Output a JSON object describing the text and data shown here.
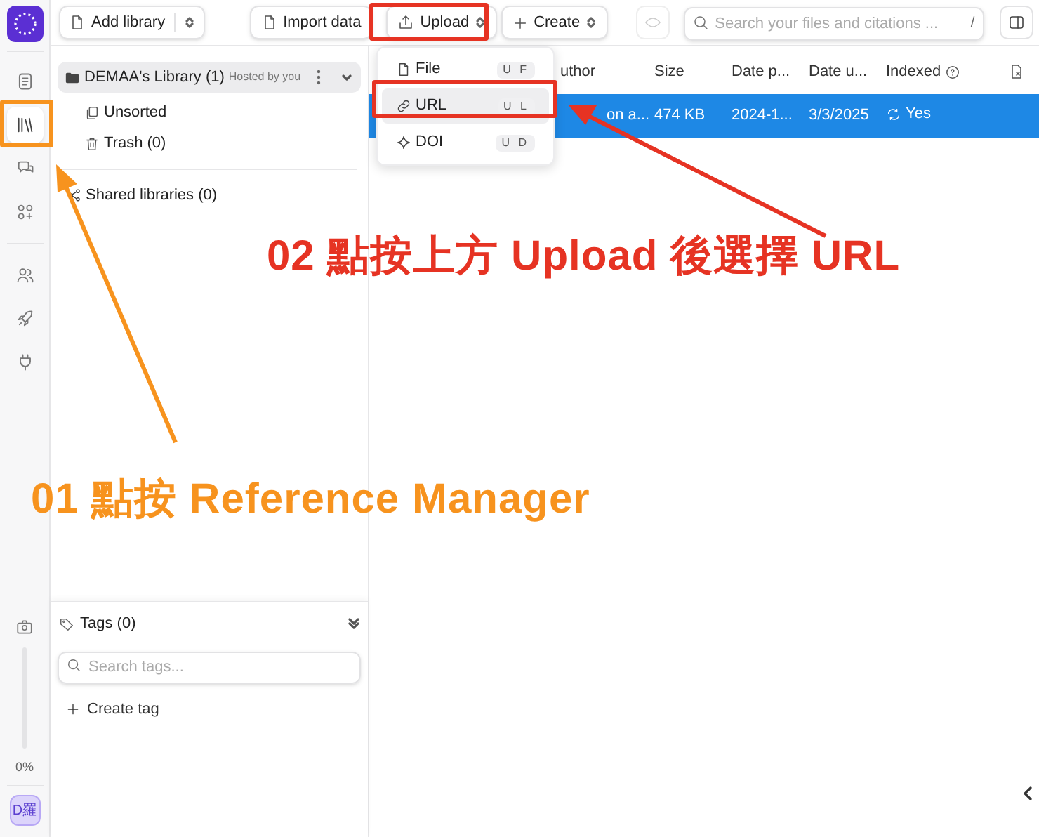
{
  "rail": {
    "items": [
      {
        "kind": "document",
        "selected": false
      },
      {
        "kind": "library",
        "selected": true
      },
      {
        "kind": "chat",
        "selected": false
      },
      {
        "kind": "apps",
        "selected": false
      },
      {
        "kind": "people",
        "selected": false
      },
      {
        "kind": "rocket",
        "selected": false
      },
      {
        "kind": "plug",
        "selected": false
      }
    ],
    "usage": {
      "level": 0,
      "reading": "0%"
    },
    "avatar": "D羅"
  },
  "toolbar": {
    "add_library": "Add library",
    "import": "Import data",
    "upload": "Upload",
    "create": "Create",
    "search": {
      "placeholder": "Search your files and citations ...",
      "shortcut": "/"
    }
  },
  "sidebar": {
    "library": {
      "name": "DEMAA's Library",
      "count": "(1)",
      "note": "Hosted by you",
      "expanded": true
    },
    "items": [
      {
        "kind": "unsorted",
        "label": "Unsorted"
      },
      {
        "kind": "trash",
        "label": "Trash (0)"
      }
    ],
    "shared": "Shared libraries (0)",
    "tags": {
      "title": "Tags (0)",
      "placeholder": "Search tags...",
      "create": "Create tag"
    }
  },
  "table": {
    "columns": [
      "uthor",
      "Size",
      "Date p...",
      "Date u...",
      "Indexed"
    ],
    "rows": [
      {
        "cells": [
          "on a...",
          "474 KB",
          "2024-1...",
          "3/3/2025",
          "Yes"
        ],
        "selected": true
      }
    ]
  },
  "upload_menu": {
    "items": [
      {
        "kind": "file",
        "label": "File",
        "keys": [
          "U",
          "F"
        ],
        "selected": false
      },
      {
        "kind": "link",
        "label": "URL",
        "keys": [
          "U",
          "L"
        ],
        "selected": true
      },
      {
        "kind": "doi",
        "label": "DOI",
        "keys": [
          "U",
          "D"
        ],
        "selected": false
      }
    ]
  },
  "annotations": [
    {
      "text": "02 點按上方 Upload 後選擇 URL",
      "color": "#e63323"
    },
    {
      "text": "01 點按 Reference Manager",
      "color": "#f7931e"
    }
  ]
}
